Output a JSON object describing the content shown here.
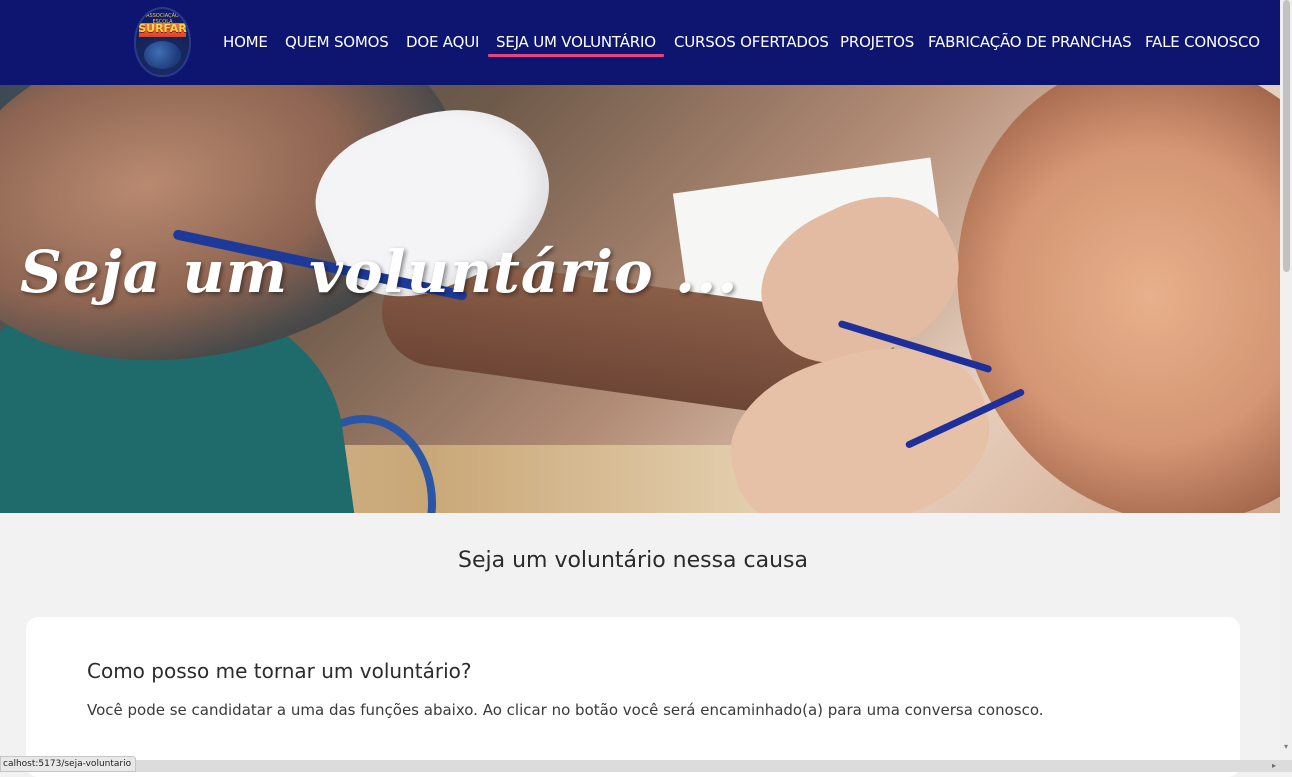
{
  "logo": {
    "top_text": "ASSOCIAÇÃO ESCOLA",
    "brand": "SURFAR"
  },
  "nav": {
    "items": [
      {
        "label": "HOME"
      },
      {
        "label": "QUEM SOMOS"
      },
      {
        "label": "DOE AQUI"
      },
      {
        "label": "SEJA UM VOLUNTÁRIO",
        "active": true
      },
      {
        "label": "CURSOS OFERTADOS"
      },
      {
        "label": "PROJETOS"
      },
      {
        "label": "FABRICAÇÃO DE PRANCHAS"
      },
      {
        "label": "FALE CONOSCO"
      }
    ]
  },
  "hero": {
    "title": "Seja um voluntário ..."
  },
  "main": {
    "section_title": "Seja um voluntário nessa causa",
    "card": {
      "title": "Como posso me tornar um voluntário?",
      "text": "Você pode se candidatar a uma das funções abaixo. Ao clicar no botão você será encaminhado(a) para uma conversa conosco."
    }
  },
  "status_bar": {
    "url": "calhost:5173/seja-voluntario"
  },
  "colors": {
    "navbar": "#0d1570",
    "active_underline": "#e8437f",
    "page_bg": "#f2f2f2"
  }
}
